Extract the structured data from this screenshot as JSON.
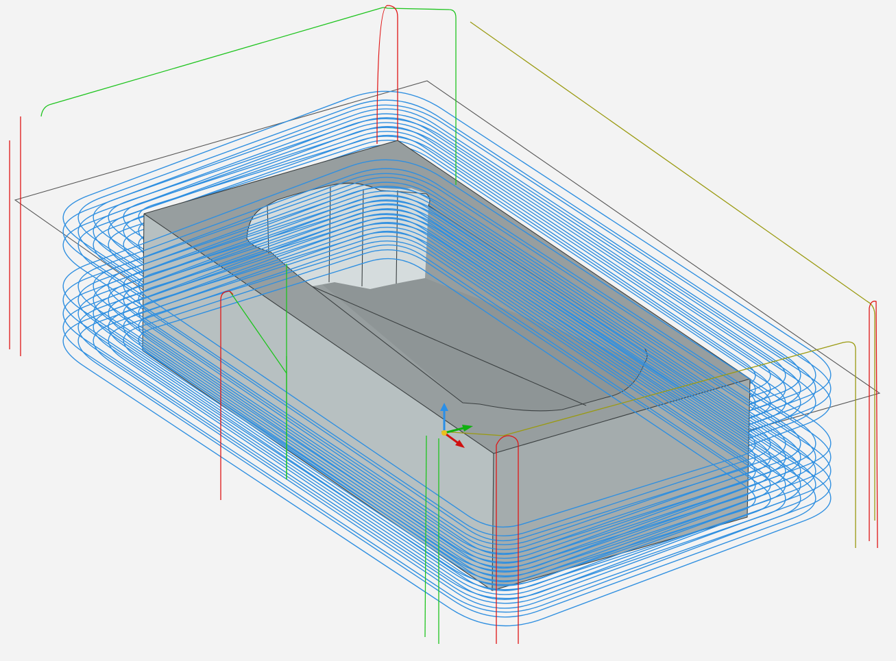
{
  "viewport": {
    "background": "#f3f3f3"
  },
  "colors": {
    "toolpath": "#2f8fe0",
    "plunge": "#e01515",
    "retract": "#1ec41e",
    "link": "#9a9a10",
    "stock_outline": "#555555",
    "part_top": "#979e9f",
    "part_front": "#b7c0c1",
    "part_side": "#a4acad",
    "pocket_floor": "#8e9596",
    "pocket_wall": "#d5dcdd",
    "axis_x": "#d01010",
    "axis_y": "#10b010",
    "axis_z": "#2a8fe8"
  },
  "icons": {
    "triad": "origin-triad-icon"
  }
}
